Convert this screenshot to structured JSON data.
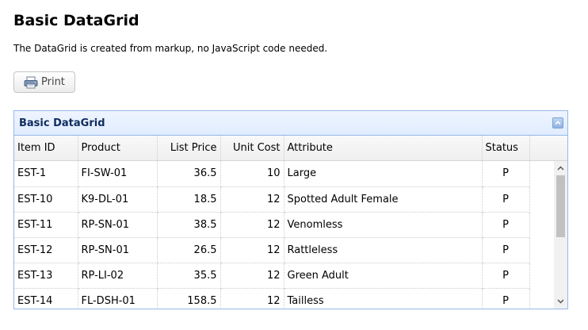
{
  "page": {
    "title": "Basic DataGrid",
    "description": "The DataGrid is created from markup, no JavaScript code needed."
  },
  "toolbar": {
    "print_label": "Print",
    "print_icon": "printer-icon"
  },
  "grid": {
    "title": "Basic DataGrid",
    "collapse_icon": "collapse-icon",
    "columns": [
      "Item ID",
      "Product",
      "List Price",
      "Unit Cost",
      "Attribute",
      "Status"
    ],
    "rows": [
      [
        "EST-1",
        "FI-SW-01",
        "36.5",
        "10",
        "Large",
        "P"
      ],
      [
        "EST-10",
        "K9-DL-01",
        "18.5",
        "12",
        "Spotted Adult Female",
        "P"
      ],
      [
        "EST-11",
        "RP-SN-01",
        "38.5",
        "12",
        "Venomless",
        "P"
      ],
      [
        "EST-12",
        "RP-SN-01",
        "26.5",
        "12",
        "Rattleless",
        "P"
      ],
      [
        "EST-13",
        "RP-LI-02",
        "35.5",
        "12",
        "Green Adult",
        "P"
      ],
      [
        "EST-14",
        "FL-DSH-01",
        "158.5",
        "12",
        "Tailless",
        "P"
      ]
    ]
  },
  "colors": {
    "panel_border": "#95b8e7",
    "panel_title": "#0e2d5f"
  }
}
